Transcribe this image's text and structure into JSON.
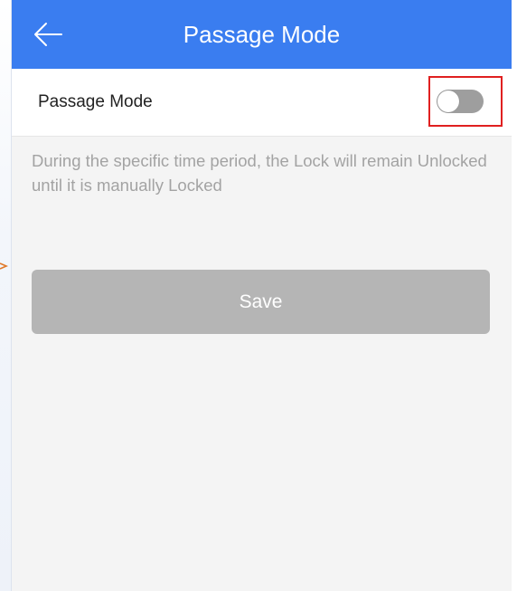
{
  "header": {
    "title": "Passage Mode",
    "back_icon": "arrow-left-icon",
    "background_color": "#3a7df0"
  },
  "passage_mode_row": {
    "label": "Passage Mode",
    "toggle_on": false,
    "highlight_color": "#e02020"
  },
  "description": "During the specific time period, the Lock will remain Unlocked until it is manually Locked",
  "save_button": {
    "label": "Save",
    "background_color": "#b5b5b5"
  }
}
